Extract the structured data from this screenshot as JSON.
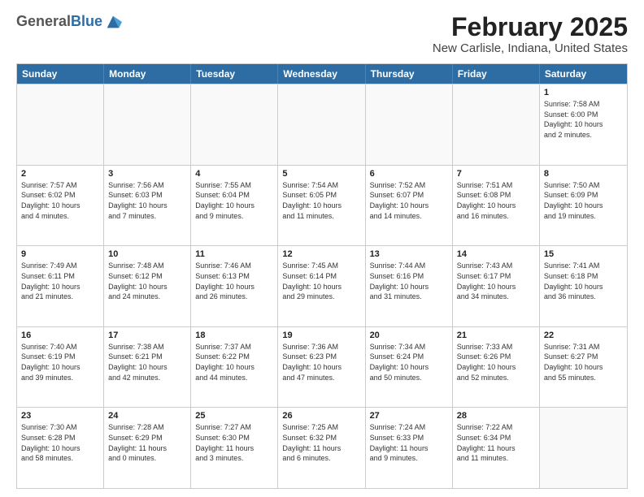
{
  "logo": {
    "general": "General",
    "blue": "Blue"
  },
  "title": "February 2025",
  "location": "New Carlisle, Indiana, United States",
  "header_days": [
    "Sunday",
    "Monday",
    "Tuesday",
    "Wednesday",
    "Thursday",
    "Friday",
    "Saturday"
  ],
  "weeks": [
    [
      {
        "day": "",
        "info": ""
      },
      {
        "day": "",
        "info": ""
      },
      {
        "day": "",
        "info": ""
      },
      {
        "day": "",
        "info": ""
      },
      {
        "day": "",
        "info": ""
      },
      {
        "day": "",
        "info": ""
      },
      {
        "day": "1",
        "info": "Sunrise: 7:58 AM\nSunset: 6:00 PM\nDaylight: 10 hours\nand 2 minutes."
      }
    ],
    [
      {
        "day": "2",
        "info": "Sunrise: 7:57 AM\nSunset: 6:02 PM\nDaylight: 10 hours\nand 4 minutes."
      },
      {
        "day": "3",
        "info": "Sunrise: 7:56 AM\nSunset: 6:03 PM\nDaylight: 10 hours\nand 7 minutes."
      },
      {
        "day": "4",
        "info": "Sunrise: 7:55 AM\nSunset: 6:04 PM\nDaylight: 10 hours\nand 9 minutes."
      },
      {
        "day": "5",
        "info": "Sunrise: 7:54 AM\nSunset: 6:05 PM\nDaylight: 10 hours\nand 11 minutes."
      },
      {
        "day": "6",
        "info": "Sunrise: 7:52 AM\nSunset: 6:07 PM\nDaylight: 10 hours\nand 14 minutes."
      },
      {
        "day": "7",
        "info": "Sunrise: 7:51 AM\nSunset: 6:08 PM\nDaylight: 10 hours\nand 16 minutes."
      },
      {
        "day": "8",
        "info": "Sunrise: 7:50 AM\nSunset: 6:09 PM\nDaylight: 10 hours\nand 19 minutes."
      }
    ],
    [
      {
        "day": "9",
        "info": "Sunrise: 7:49 AM\nSunset: 6:11 PM\nDaylight: 10 hours\nand 21 minutes."
      },
      {
        "day": "10",
        "info": "Sunrise: 7:48 AM\nSunset: 6:12 PM\nDaylight: 10 hours\nand 24 minutes."
      },
      {
        "day": "11",
        "info": "Sunrise: 7:46 AM\nSunset: 6:13 PM\nDaylight: 10 hours\nand 26 minutes."
      },
      {
        "day": "12",
        "info": "Sunrise: 7:45 AM\nSunset: 6:14 PM\nDaylight: 10 hours\nand 29 minutes."
      },
      {
        "day": "13",
        "info": "Sunrise: 7:44 AM\nSunset: 6:16 PM\nDaylight: 10 hours\nand 31 minutes."
      },
      {
        "day": "14",
        "info": "Sunrise: 7:43 AM\nSunset: 6:17 PM\nDaylight: 10 hours\nand 34 minutes."
      },
      {
        "day": "15",
        "info": "Sunrise: 7:41 AM\nSunset: 6:18 PM\nDaylight: 10 hours\nand 36 minutes."
      }
    ],
    [
      {
        "day": "16",
        "info": "Sunrise: 7:40 AM\nSunset: 6:19 PM\nDaylight: 10 hours\nand 39 minutes."
      },
      {
        "day": "17",
        "info": "Sunrise: 7:38 AM\nSunset: 6:21 PM\nDaylight: 10 hours\nand 42 minutes."
      },
      {
        "day": "18",
        "info": "Sunrise: 7:37 AM\nSunset: 6:22 PM\nDaylight: 10 hours\nand 44 minutes."
      },
      {
        "day": "19",
        "info": "Sunrise: 7:36 AM\nSunset: 6:23 PM\nDaylight: 10 hours\nand 47 minutes."
      },
      {
        "day": "20",
        "info": "Sunrise: 7:34 AM\nSunset: 6:24 PM\nDaylight: 10 hours\nand 50 minutes."
      },
      {
        "day": "21",
        "info": "Sunrise: 7:33 AM\nSunset: 6:26 PM\nDaylight: 10 hours\nand 52 minutes."
      },
      {
        "day": "22",
        "info": "Sunrise: 7:31 AM\nSunset: 6:27 PM\nDaylight: 10 hours\nand 55 minutes."
      }
    ],
    [
      {
        "day": "23",
        "info": "Sunrise: 7:30 AM\nSunset: 6:28 PM\nDaylight: 10 hours\nand 58 minutes."
      },
      {
        "day": "24",
        "info": "Sunrise: 7:28 AM\nSunset: 6:29 PM\nDaylight: 11 hours\nand 0 minutes."
      },
      {
        "day": "25",
        "info": "Sunrise: 7:27 AM\nSunset: 6:30 PM\nDaylight: 11 hours\nand 3 minutes."
      },
      {
        "day": "26",
        "info": "Sunrise: 7:25 AM\nSunset: 6:32 PM\nDaylight: 11 hours\nand 6 minutes."
      },
      {
        "day": "27",
        "info": "Sunrise: 7:24 AM\nSunset: 6:33 PM\nDaylight: 11 hours\nand 9 minutes."
      },
      {
        "day": "28",
        "info": "Sunrise: 7:22 AM\nSunset: 6:34 PM\nDaylight: 11 hours\nand 11 minutes."
      },
      {
        "day": "",
        "info": ""
      }
    ]
  ]
}
